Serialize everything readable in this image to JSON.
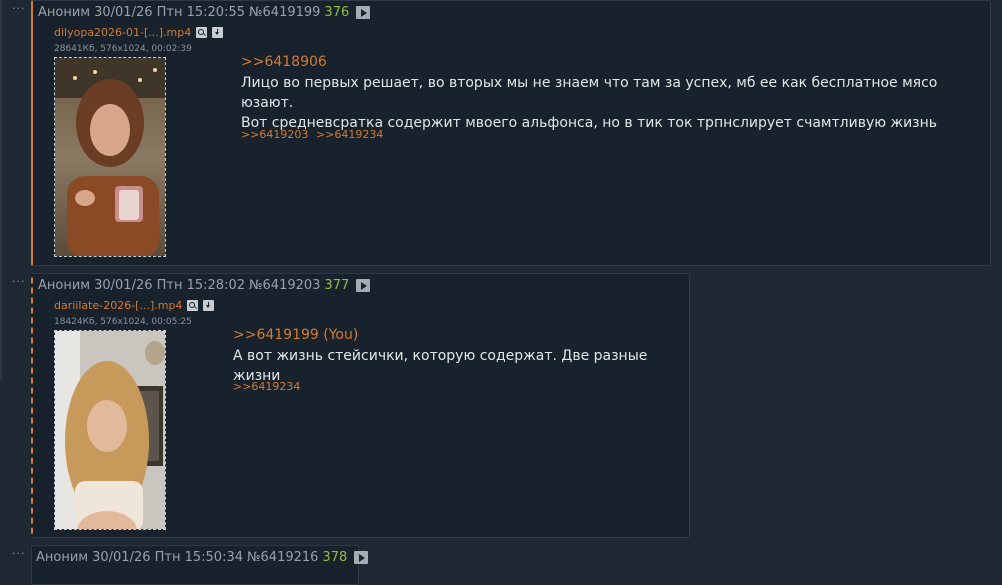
{
  "posts": [
    {
      "author": "Аноним",
      "datetime": "30/01/26 Птн 15:20:55",
      "number": "№6419199",
      "count": "376",
      "file_name": "dilyopa2026-01-[...].mp4",
      "file_info": "28641Кб, 576x1024, 00:02:39",
      "reply_to": ">>6418906",
      "text_lines": [
        "Лицо во первых решает, во вторых мы не знаем что там за успех, мб ее как бесплатное мясо юзают.",
        "Вот средневсратка содержит мвоего альфонса, но в тик ток трпнслирует счамтливую жизнь"
      ],
      "backlinks": [
        ">>6419203",
        ">>6419234"
      ]
    },
    {
      "author": "Аноним",
      "datetime": "30/01/26 Птн 15:28:02",
      "number": "№6419203",
      "count": "377",
      "file_name": "dariilate-2026-[...].mp4",
      "file_info": "18424Кб, 576x1024, 00:05:25",
      "reply_to": ">>6419199 (You)",
      "text_lines": [
        "А вот жизнь стейсички, которую содержат. Две разные жизни"
      ],
      "backlinks": [
        ">>6419234"
      ]
    },
    {
      "author": "Аноним",
      "datetime": "30/01/26 Птн 15:50:34",
      "number": "№6419216",
      "count": "378"
    }
  ],
  "ui": {
    "post_menu": "···"
  },
  "colors": {
    "background": "#1d2833",
    "post_bg": "#17222c",
    "accent": "#d57a31",
    "count_green": "#8dbf3d"
  }
}
